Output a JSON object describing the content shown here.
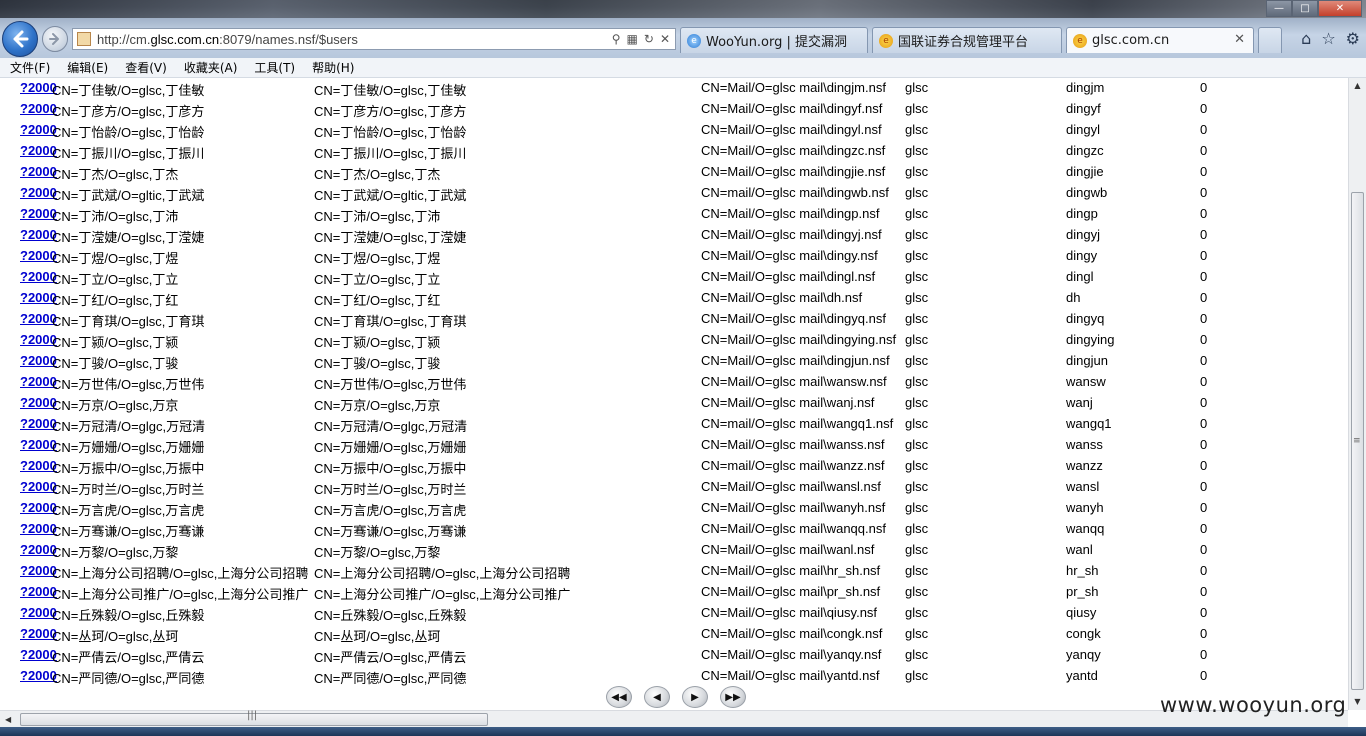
{
  "browser": {
    "url_prefix": "http://cm.",
    "url_domain": "glsc.com.cn",
    "url_suffix": ":8079/names.nsf/$users",
    "tabs": [
      {
        "label": "WooYun.org | 提交漏洞"
      },
      {
        "label": "国联证券合规管理平台"
      },
      {
        "label": "glsc.com.cn"
      }
    ]
  },
  "menu": [
    "文件(F)",
    "编辑(E)",
    "查看(V)",
    "收藏夹(A)",
    "工具(T)",
    "帮助(H)"
  ],
  "rows": [
    {
      "link": "?2000",
      "name": "CN=丁佳敏/O=glsc,丁佳敏",
      "full": "CN=丁佳敏/O=glsc,丁佳敏",
      "mail": "CN=Mail/O=glsc mail\\dingjm.nsf",
      "org": "glsc",
      "short": "dingjm",
      "num": "0"
    },
    {
      "link": "?2000",
      "name": "CN=丁彦方/O=glsc,丁彦方",
      "full": "CN=丁彦方/O=glsc,丁彦方",
      "mail": "CN=Mail/O=glsc mail\\dingyf.nsf",
      "org": "glsc",
      "short": "dingyf",
      "num": "0"
    },
    {
      "link": "?2000",
      "name": "CN=丁怡龄/O=glsc,丁怡龄",
      "full": "CN=丁怡龄/O=glsc,丁怡龄",
      "mail": "CN=Mail/O=glsc mail\\dingyl.nsf",
      "org": "glsc",
      "short": "dingyl",
      "num": "0"
    },
    {
      "link": "?2000",
      "name": "CN=丁振川/O=glsc,丁振川",
      "full": "CN=丁振川/O=glsc,丁振川",
      "mail": "CN=Mail/O=glsc mail\\dingzc.nsf",
      "org": "glsc",
      "short": "dingzc",
      "num": "0"
    },
    {
      "link": "?2000",
      "name": "CN=丁杰/O=glsc,丁杰",
      "full": "CN=丁杰/O=glsc,丁杰",
      "mail": "CN=Mail/O=glsc mail\\dingjie.nsf",
      "org": "glsc",
      "short": "dingjie",
      "num": "0"
    },
    {
      "link": "?2000",
      "name": "CN=丁武斌/O=gltic,丁武斌",
      "full": "CN=丁武斌/O=gltic,丁武斌",
      "mail": "CN=mail/O=glsc mail\\dingwb.nsf",
      "org": "glsc",
      "short": "dingwb",
      "num": "0"
    },
    {
      "link": "?2000",
      "name": "CN=丁沛/O=glsc,丁沛",
      "full": "CN=丁沛/O=glsc,丁沛",
      "mail": "CN=Mail/O=glsc mail\\dingp.nsf",
      "org": "glsc",
      "short": "dingp",
      "num": "0"
    },
    {
      "link": "?2000",
      "name": "CN=丁滢婕/O=glsc,丁滢婕",
      "full": "CN=丁滢婕/O=glsc,丁滢婕",
      "mail": "CN=Mail/O=glsc mail\\dingyj.nsf",
      "org": "glsc",
      "short": "dingyj",
      "num": "0"
    },
    {
      "link": "?2000",
      "name": "CN=丁煜/O=glsc,丁煜",
      "full": "CN=丁煜/O=glsc,丁煜",
      "mail": "CN=Mail/O=glsc mail\\dingy.nsf",
      "org": "glsc",
      "short": "dingy",
      "num": "0"
    },
    {
      "link": "?2000",
      "name": "CN=丁立/O=glsc,丁立",
      "full": "CN=丁立/O=glsc,丁立",
      "mail": "CN=Mail/O=glsc mail\\dingl.nsf",
      "org": "glsc",
      "short": "dingl",
      "num": "0"
    },
    {
      "link": "?2000",
      "name": "CN=丁红/O=glsc,丁红",
      "full": "CN=丁红/O=glsc,丁红",
      "mail": "CN=Mail/O=glsc mail\\dh.nsf",
      "org": "glsc",
      "short": "dh",
      "num": "0"
    },
    {
      "link": "?2000",
      "name": "CN=丁育琪/O=glsc,丁育琪",
      "full": "CN=丁育琪/O=glsc,丁育琪",
      "mail": "CN=Mail/O=glsc mail\\dingyq.nsf",
      "org": "glsc",
      "short": "dingyq",
      "num": "0"
    },
    {
      "link": "?2000",
      "name": "CN=丁颍/O=glsc,丁颍",
      "full": "CN=丁颍/O=glsc,丁颍",
      "mail": "CN=Mail/O=glsc mail\\dingying.nsf",
      "org": "glsc",
      "short": "dingying",
      "num": "0"
    },
    {
      "link": "?2000",
      "name": "CN=丁骏/O=glsc,丁骏",
      "full": "CN=丁骏/O=glsc,丁骏",
      "mail": "CN=Mail/O=glsc mail\\dingjun.nsf",
      "org": "glsc",
      "short": "dingjun",
      "num": "0"
    },
    {
      "link": "?2000",
      "name": "CN=万世伟/O=glsc,万世伟",
      "full": "CN=万世伟/O=glsc,万世伟",
      "mail": "CN=Mail/O=glsc mail\\wansw.nsf",
      "org": "glsc",
      "short": "wansw",
      "num": "0"
    },
    {
      "link": "?2000",
      "name": "CN=万京/O=glsc,万京",
      "full": "CN=万京/O=glsc,万京",
      "mail": "CN=Mail/O=glsc mail\\wanj.nsf",
      "org": "glsc",
      "short": "wanj",
      "num": "0"
    },
    {
      "link": "?2000",
      "name": "CN=万冠清/O=glgc,万冠清",
      "full": "CN=万冠清/O=glgc,万冠清",
      "mail": "CN=mail/O=glsc mail\\wangq1.nsf",
      "org": "glsc",
      "short": "wangq1",
      "num": "0"
    },
    {
      "link": "?2000",
      "name": "CN=万姗姗/O=glsc,万姗姗",
      "full": "CN=万姗姗/O=glsc,万姗姗",
      "mail": "CN=Mail/O=glsc mail\\wanss.nsf",
      "org": "glsc",
      "short": "wanss",
      "num": "0"
    },
    {
      "link": "?2000",
      "name": "CN=万振中/O=glsc,万振中",
      "full": "CN=万振中/O=glsc,万振中",
      "mail": "CN=mail/O=glsc mail\\wanzz.nsf",
      "org": "glsc",
      "short": "wanzz",
      "num": "0"
    },
    {
      "link": "?2000",
      "name": "CN=万时兰/O=glsc,万时兰",
      "full": "CN=万时兰/O=glsc,万时兰",
      "mail": "CN=Mail/O=glsc mail\\wansl.nsf",
      "org": "glsc",
      "short": "wansl",
      "num": "0"
    },
    {
      "link": "?2000",
      "name": "CN=万言虎/O=glsc,万言虎",
      "full": "CN=万言虎/O=glsc,万言虎",
      "mail": "CN=Mail/O=glsc mail\\wanyh.nsf",
      "org": "glsc",
      "short": "wanyh",
      "num": "0"
    },
    {
      "link": "?2000",
      "name": "CN=万骞谦/O=glsc,万骞谦",
      "full": "CN=万骞谦/O=glsc,万骞谦",
      "mail": "CN=Mail/O=glsc mail\\wanqq.nsf",
      "org": "glsc",
      "short": "wanqq",
      "num": "0"
    },
    {
      "link": "?2000",
      "name": "CN=万黎/O=glsc,万黎",
      "full": "CN=万黎/O=glsc,万黎",
      "mail": "CN=Mail/O=glsc mail\\wanl.nsf",
      "org": "glsc",
      "short": "wanl",
      "num": "0"
    },
    {
      "link": "?2000",
      "name": "CN=上海分公司招聘/O=glsc,上海分公司招聘",
      "full": "CN=上海分公司招聘/O=glsc,上海分公司招聘",
      "mail": "CN=Mail/O=glsc mail\\hr_sh.nsf",
      "org": "glsc",
      "short": "hr_sh",
      "num": "0"
    },
    {
      "link": "?2000",
      "name": "CN=上海分公司推广/O=glsc,上海分公司推广",
      "full": "CN=上海分公司推广/O=glsc,上海分公司推广",
      "mail": "CN=Mail/O=glsc mail\\pr_sh.nsf",
      "org": "glsc",
      "short": "pr_sh",
      "num": "0"
    },
    {
      "link": "?2000",
      "name": "CN=丘殊毅/O=glsc,丘殊毅",
      "full": "CN=丘殊毅/O=glsc,丘殊毅",
      "mail": "CN=Mail/O=glsc mail\\qiusy.nsf",
      "org": "glsc",
      "short": "qiusy",
      "num": "0"
    },
    {
      "link": "?2000",
      "name": "CN=丛珂/O=glsc,丛珂",
      "full": "CN=丛珂/O=glsc,丛珂",
      "mail": "CN=Mail/O=glsc mail\\congk.nsf",
      "org": "glsc",
      "short": "congk",
      "num": "0"
    },
    {
      "link": "?2000",
      "name": "CN=严倩云/O=glsc,严倩云",
      "full": "CN=严倩云/O=glsc,严倩云",
      "mail": "CN=Mail/O=glsc mail\\yanqy.nsf",
      "org": "glsc",
      "short": "yanqy",
      "num": "0"
    },
    {
      "link": "?2000",
      "name": "CN=严同德/O=glsc,严同德",
      "full": "CN=严同德/O=glsc,严同德",
      "mail": "CN=Mail/O=glsc mail\\yantd.nsf",
      "org": "glsc",
      "short": "yantd",
      "num": "0"
    }
  ],
  "watermark": "www.wooyun.org",
  "icons": {
    "back": "back-arrow-icon",
    "forward": "forward-arrow-icon",
    "pager": [
      "first-page-icon",
      "prev-page-icon",
      "next-page-icon",
      "last-page-icon"
    ]
  }
}
